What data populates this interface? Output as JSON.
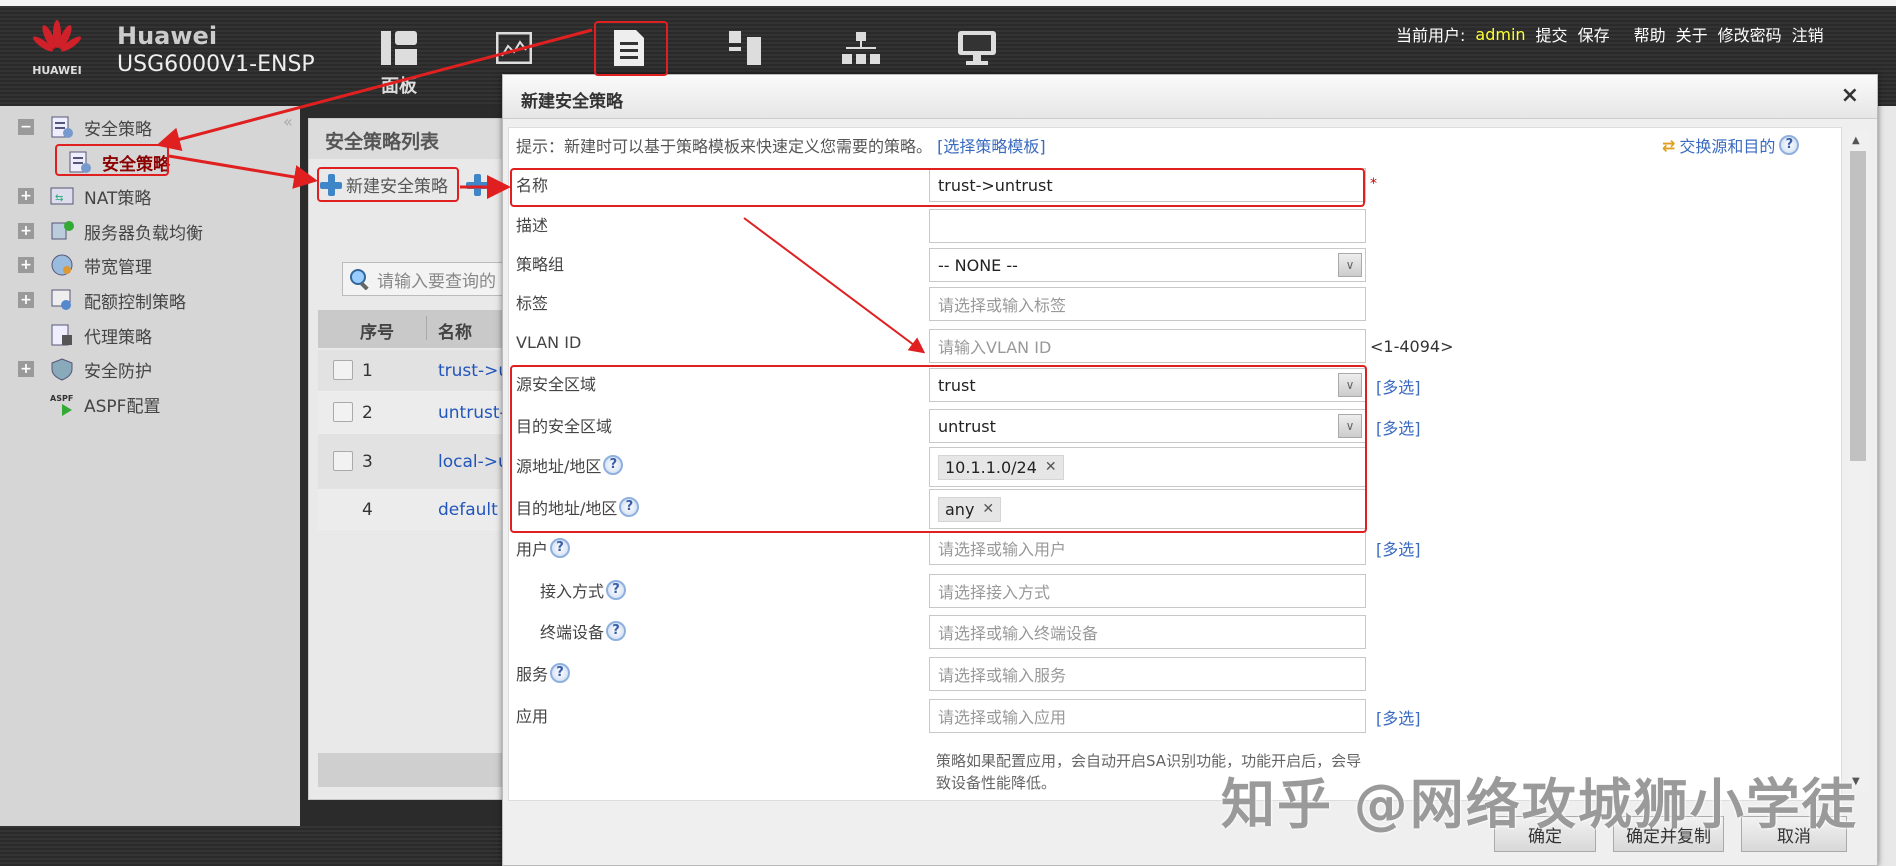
{
  "header": {
    "brand_logo_text": "HUAWEI",
    "brand_name": "Huawei",
    "device": "USG6000V1-ENSP",
    "nav": [
      {
        "icon": "dashboard-icon",
        "label": "面板"
      },
      {
        "icon": "monitor-chart-icon",
        "label": ""
      },
      {
        "icon": "policy-document-icon",
        "label": "",
        "selected": true
      },
      {
        "icon": "object-icon",
        "label": ""
      },
      {
        "icon": "network-icon",
        "label": ""
      },
      {
        "icon": "system-icon",
        "label": ""
      }
    ],
    "user_label": "当前用户:",
    "user": "admin",
    "links": [
      "提交",
      "保存",
      "帮助",
      "关于",
      "修改密码",
      "注销"
    ]
  },
  "sidebar": {
    "items": [
      {
        "label": "安全策略",
        "expander": "minus",
        "icon": "security-policy-icon"
      },
      {
        "label": "安全策略",
        "icon": "security-policy-icon",
        "selected": true
      },
      {
        "label": "NAT策略",
        "expander": "plus",
        "icon": "nat-icon"
      },
      {
        "label": "服务器负载均衡",
        "expander": "plus",
        "icon": "server-lb-icon"
      },
      {
        "label": "带宽管理",
        "expander": "plus",
        "icon": "bandwidth-icon"
      },
      {
        "label": "配额控制策略",
        "expander": "plus",
        "icon": "quota-icon"
      },
      {
        "label": "代理策略",
        "icon": "proxy-icon"
      },
      {
        "label": "安全防护",
        "expander": "plus",
        "icon": "shield-icon"
      },
      {
        "label": "ASPF配置",
        "icon": "aspf-icon"
      }
    ]
  },
  "list": {
    "title": "安全策略列表",
    "new_button": "新建安全策略",
    "search_placeholder": "请输入要查询的",
    "columns": [
      "序号",
      "名称"
    ],
    "rows": [
      {
        "num": "1",
        "name": "trust->u"
      },
      {
        "num": "2",
        "name": "untrust-"
      },
      {
        "num": "3",
        "name": "local->u"
      },
      {
        "num": "4",
        "name": "default"
      }
    ]
  },
  "dialog": {
    "title": "新建安全策略",
    "close": "×",
    "hint": "提示：新建时可以基于策略模板来快速定义您需要的策略。",
    "hint_link": "[选择策略模板]",
    "swap": "交换源和目的",
    "fields": {
      "name": {
        "label": "名称",
        "value": "trust->untrust",
        "required": "*"
      },
      "desc": {
        "label": "描述",
        "value": ""
      },
      "group": {
        "label": "策略组",
        "value": "-- NONE --"
      },
      "tag": {
        "label": "标签",
        "placeholder": "请选择或输入标签"
      },
      "vlan": {
        "label": "VLAN ID",
        "placeholder": "请输入VLAN ID",
        "range": "<1-4094>"
      },
      "src_zone": {
        "label": "源安全区域",
        "value": "trust",
        "multi": "[多选]"
      },
      "dst_zone": {
        "label": "目的安全区域",
        "value": "untrust",
        "multi": "[多选]"
      },
      "src_addr": {
        "label": "源地址/地区",
        "tag": "10.1.1.0/24"
      },
      "dst_addr": {
        "label": "目的地址/地区",
        "tag": "any"
      },
      "user": {
        "label": "用户",
        "placeholder": "请选择或输入用户",
        "multi": "[多选]"
      },
      "access": {
        "label": "接入方式",
        "placeholder": "请选择接入方式"
      },
      "device": {
        "label": "终端设备",
        "placeholder": "请选择或输入终端设备"
      },
      "service": {
        "label": "服务",
        "placeholder": "请选择或输入服务"
      },
      "app": {
        "label": "应用",
        "placeholder": "请选择或输入应用",
        "multi": "[多选]"
      }
    },
    "note": "策略如果配置应用，会自动开启SA识别功能，功能开启后，会导致设备性能降低。",
    "buttons": {
      "ok": "确定",
      "ok_copy": "确定并复制",
      "cancel": "取消"
    }
  },
  "watermark": "知乎 @网络攻城狮小学徒",
  "colors": {
    "annotation": "#e02020",
    "link": "#3a6bc0",
    "header": "#2e2e2e"
  }
}
